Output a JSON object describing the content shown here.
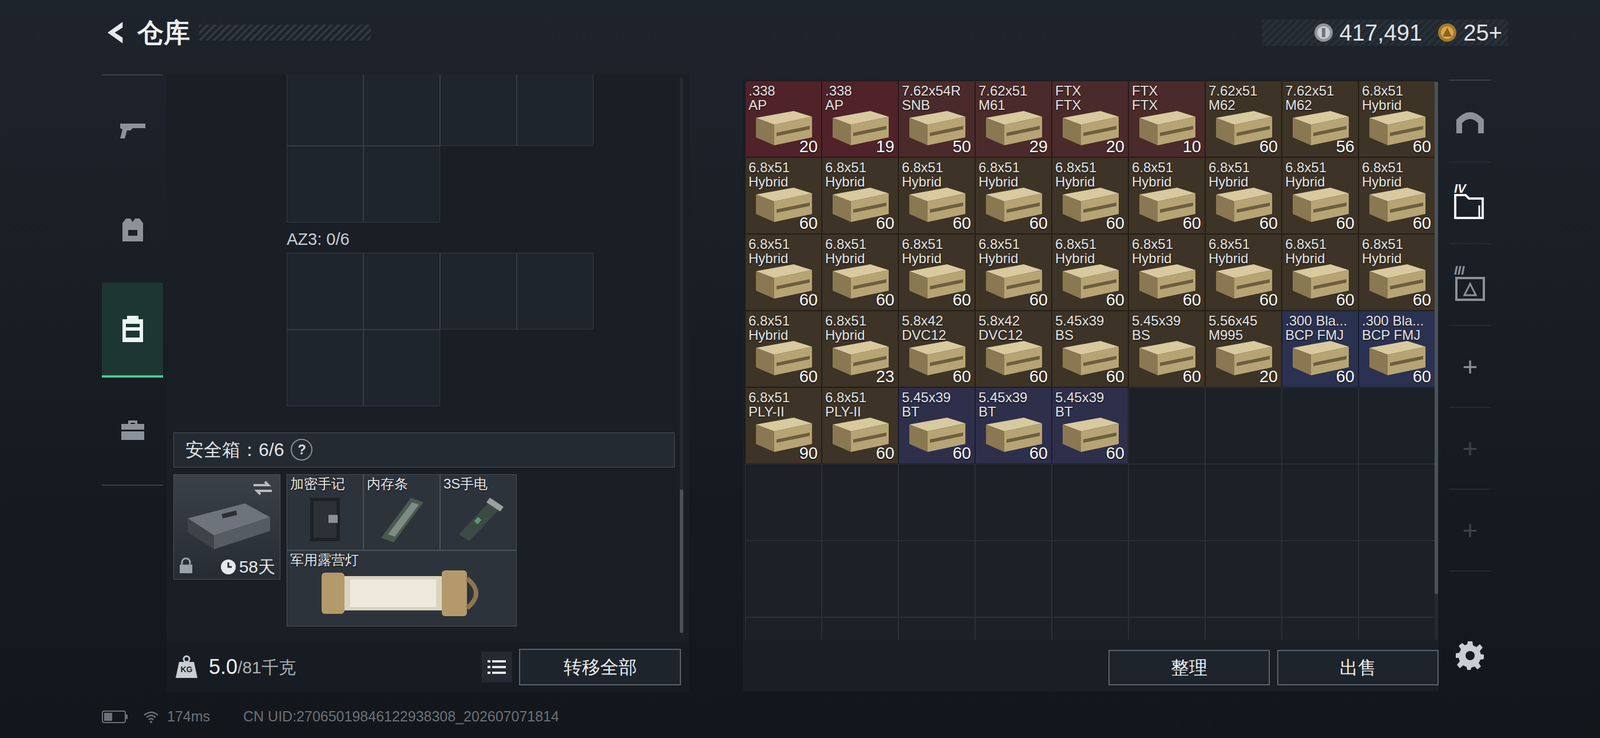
{
  "header": {
    "title": "仓库"
  },
  "currencies": [
    {
      "amount": "417,491"
    },
    {
      "amount": "25+"
    }
  ],
  "sidebar": {
    "items": [
      {
        "selected": false
      },
      {
        "selected": false
      },
      {
        "selected": true
      },
      {
        "selected": false
      }
    ]
  },
  "rig": {
    "label": "AZ3: 0/6"
  },
  "secure": {
    "label": "安全箱：6/6",
    "help": "?",
    "days": "58天",
    "locked": true,
    "items": [
      {
        "name": "加密手记"
      },
      {
        "name": "内存条"
      },
      {
        "name": "3S手电"
      },
      {
        "name": "军用露营灯"
      }
    ]
  },
  "weight": {
    "icon": "KG",
    "value": "5.0",
    "capacity": "/81千克"
  },
  "transfer_button": "转移全部",
  "stash": {
    "cells": [
      {
        "line1": ".338",
        "line2": "AP",
        "count": "20",
        "color": "#4f2329"
      },
      {
        "line1": ".338",
        "line2": "AP",
        "count": "19",
        "color": "#4f2329"
      },
      {
        "line1": "7.62x54R",
        "line2": "SNB",
        "count": "50",
        "color": "#4a2a2a"
      },
      {
        "line1": "7.62x51",
        "line2": "M61",
        "count": "29",
        "color": "#4a2a2a"
      },
      {
        "line1": "FTX",
        "line2": "FTX",
        "count": "20",
        "color": "#4a2a2a"
      },
      {
        "line1": "FTX",
        "line2": "FTX",
        "count": "10",
        "color": "#4a2a2a"
      },
      {
        "line1": "7.62x51",
        "line2": "M62",
        "count": "60",
        "color": "#3d3326"
      },
      {
        "line1": "7.62x51",
        "line2": "M62",
        "count": "56",
        "color": "#3d3326"
      },
      {
        "line1": "6.8x51",
        "line2": "Hybrid",
        "count": "60",
        "color": "#3d3326"
      },
      {
        "line1": "6.8x51",
        "line2": "Hybrid",
        "count": "60",
        "color": "#3d3326"
      },
      {
        "line1": "6.8x51",
        "line2": "Hybrid",
        "count": "60",
        "color": "#3d3326"
      },
      {
        "line1": "6.8x51",
        "line2": "Hybrid",
        "count": "60",
        "color": "#3d3326"
      },
      {
        "line1": "6.8x51",
        "line2": "Hybrid",
        "count": "60",
        "color": "#3d3326"
      },
      {
        "line1": "6.8x51",
        "line2": "Hybrid",
        "count": "60",
        "color": "#3d3326"
      },
      {
        "line1": "6.8x51",
        "line2": "Hybrid",
        "count": "60",
        "color": "#3d3326"
      },
      {
        "line1": "6.8x51",
        "line2": "Hybrid",
        "count": "60",
        "color": "#3d3326"
      },
      {
        "line1": "6.8x51",
        "line2": "Hybrid",
        "count": "60",
        "color": "#3d3326"
      },
      {
        "line1": "6.8x51",
        "line2": "Hybrid",
        "count": "60",
        "color": "#3d3326"
      },
      {
        "line1": "6.8x51",
        "line2": "Hybrid",
        "count": "60",
        "color": "#3d3326"
      },
      {
        "line1": "6.8x51",
        "line2": "Hybrid",
        "count": "60",
        "color": "#3d3326"
      },
      {
        "line1": "6.8x51",
        "line2": "Hybrid",
        "count": "60",
        "color": "#3d3326"
      },
      {
        "line1": "6.8x51",
        "line2": "Hybrid",
        "count": "60",
        "color": "#3d3326"
      },
      {
        "line1": "6.8x51",
        "line2": "Hybrid",
        "count": "60",
        "color": "#3d3326"
      },
      {
        "line1": "6.8x51",
        "line2": "Hybrid",
        "count": "60",
        "color": "#3d3326"
      },
      {
        "line1": "6.8x51",
        "line2": "Hybrid",
        "count": "60",
        "color": "#3d3326"
      },
      {
        "line1": "6.8x51",
        "line2": "Hybrid",
        "count": "60",
        "color": "#3d3326"
      },
      {
        "line1": "6.8x51",
        "line2": "Hybrid",
        "count": "60",
        "color": "#3d3326"
      },
      {
        "line1": "6.8x51",
        "line2": "Hybrid",
        "count": "60",
        "color": "#3d3326"
      },
      {
        "line1": "6.8x51",
        "line2": "Hybrid",
        "count": "23",
        "color": "#3d3326"
      },
      {
        "line1": "5.8x42",
        "line2": "DVC12",
        "count": "60",
        "color": "#3d3326"
      },
      {
        "line1": "5.8x42",
        "line2": "DVC12",
        "count": "60",
        "color": "#3d3326"
      },
      {
        "line1": "5.45x39",
        "line2": "BS",
        "count": "60",
        "color": "#3d3326"
      },
      {
        "line1": "5.45x39",
        "line2": "BS",
        "count": "60",
        "color": "#3d3326"
      },
      {
        "line1": "5.56x45",
        "line2": "M995",
        "count": "20",
        "color": "#3d3326"
      },
      {
        "line1": ".300 Bla...",
        "line2": "BCP FMJ",
        "count": "60",
        "color": "#2b3150"
      },
      {
        "line1": ".300 Bla...",
        "line2": "BCP FMJ",
        "count": "60",
        "color": "#2b3150"
      },
      {
        "line1": "6.8x51",
        "line2": "PLY-II",
        "count": "90",
        "color": "#3d3326"
      },
      {
        "line1": "6.8x51",
        "line2": "PLY-II",
        "count": "60",
        "color": "#3d3326"
      },
      {
        "line1": "5.45x39",
        "line2": "BT",
        "count": "60",
        "color": "#2d2f4b"
      },
      {
        "line1": "5.45x39",
        "line2": "BT",
        "count": "60",
        "color": "#2d2f4b"
      },
      {
        "line1": "5.45x39",
        "line2": "BT",
        "count": "60",
        "color": "#2d2f4b"
      }
    ]
  },
  "buttons": [
    "整理",
    "出售"
  ],
  "rail": {
    "items": [
      {
        "kind": "home",
        "selected": false,
        "disabled": false
      },
      {
        "kind": "folder",
        "label": "IV",
        "selected": true,
        "disabled": false
      },
      {
        "kind": "map",
        "label": "III",
        "selected": false,
        "disabled": false
      },
      {
        "kind": "add",
        "label": "+",
        "selected": false,
        "disabled": false
      },
      {
        "kind": "add",
        "label": "+",
        "selected": false,
        "disabled": true
      },
      {
        "kind": "add",
        "label": "+",
        "selected": false,
        "disabled": true
      }
    ]
  },
  "status": {
    "ping": "174ms",
    "uid": "CN UID:27065019846122938308_202607071814"
  }
}
